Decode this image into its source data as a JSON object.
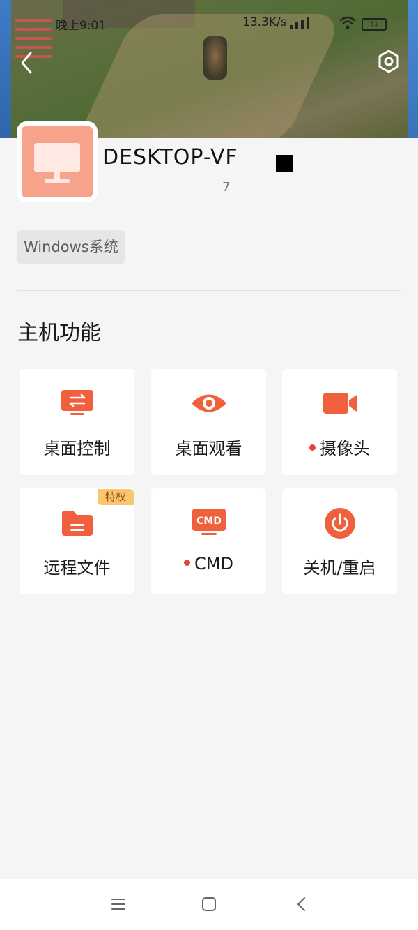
{
  "status_bar": {
    "time": "晚上9:01",
    "network_speed": "13.3K/s",
    "battery": "51"
  },
  "device": {
    "name": "DESKTOP-VF",
    "subtitle": "7",
    "os_tag": "Windows系统"
  },
  "section_title": "主机功能",
  "functions": [
    {
      "label": "桌面控制",
      "icon": "desktop-transfer-icon",
      "dot": false,
      "badge": ""
    },
    {
      "label": "桌面观看",
      "icon": "eye-icon",
      "dot": false,
      "badge": ""
    },
    {
      "label": "摄像头",
      "icon": "camera-icon",
      "dot": true,
      "badge": ""
    },
    {
      "label": "远程文件",
      "icon": "folder-icon",
      "dot": false,
      "badge": "特权"
    },
    {
      "label": "CMD",
      "icon": "cmd-icon",
      "dot": true,
      "badge": "",
      "icon_text": "CMD"
    },
    {
      "label": "关机/重启",
      "icon": "power-icon",
      "dot": false,
      "badge": ""
    }
  ],
  "colors": {
    "accent": "#f0603d",
    "avatar": "#f7a28a",
    "badge": "#fbc672",
    "dot": "#e6413b"
  },
  "nav": [
    "menu-icon",
    "home-icon",
    "back-icon"
  ]
}
